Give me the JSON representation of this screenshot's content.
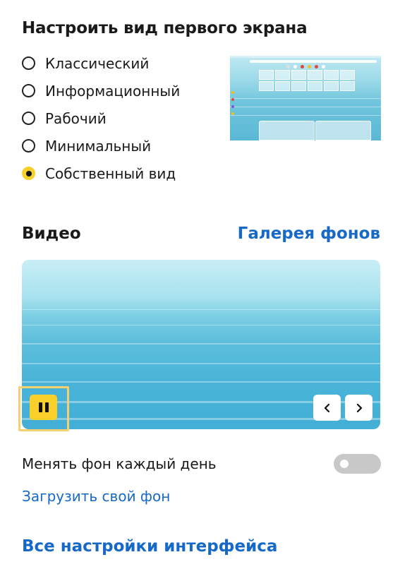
{
  "layout_section": {
    "title": "Настроить вид первого экрана",
    "options": [
      {
        "label": "Классический",
        "selected": false
      },
      {
        "label": "Информационный",
        "selected": false
      },
      {
        "label": "Рабочий",
        "selected": false
      },
      {
        "label": "Минимальный",
        "selected": false
      },
      {
        "label": "Собственный вид",
        "selected": true
      }
    ]
  },
  "video_section": {
    "title": "Видео",
    "gallery_link": "Галерея фонов",
    "pause_icon": "pause-icon",
    "prev_icon": "chevron-left-icon",
    "next_icon": "chevron-right-icon"
  },
  "settings": {
    "daily_background_label": "Менять фон каждый день",
    "daily_background_enabled": false,
    "upload_link": "Загрузить свой фон",
    "all_settings_link": "Все настройки интерфейса"
  },
  "colors": {
    "accent_yellow": "#f9cf2a",
    "link_blue": "#1769c8",
    "toggle_off": "#c8c8c8"
  }
}
